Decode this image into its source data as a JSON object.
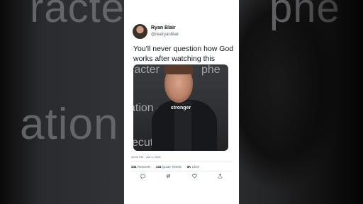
{
  "background": {
    "words": [
      "racter",
      "ation –",
      "phe"
    ]
  },
  "tweet": {
    "author_name": "Ryan Blair",
    "author_handle": "@realryanblair",
    "text": "You'll never question how God works after watching this",
    "media": {
      "overlay_words": [
        "racter",
        "ation –",
        "ecuti",
        "phe"
      ],
      "caption": "stronger"
    },
    "timestamp": "10:00 PM · Jan 1, 2026",
    "stats": [
      {
        "value": "344",
        "label": "Retweets"
      },
      {
        "value": "134",
        "label": "Quote Tweets"
      },
      {
        "value": "3K",
        "label": "Likes"
      }
    ],
    "actions": [
      "reply-icon",
      "retweet-icon",
      "like-icon",
      "share-icon"
    ]
  },
  "colors": {
    "card": "#ffffff",
    "text": "#0f1419",
    "secondary": "#536471"
  }
}
